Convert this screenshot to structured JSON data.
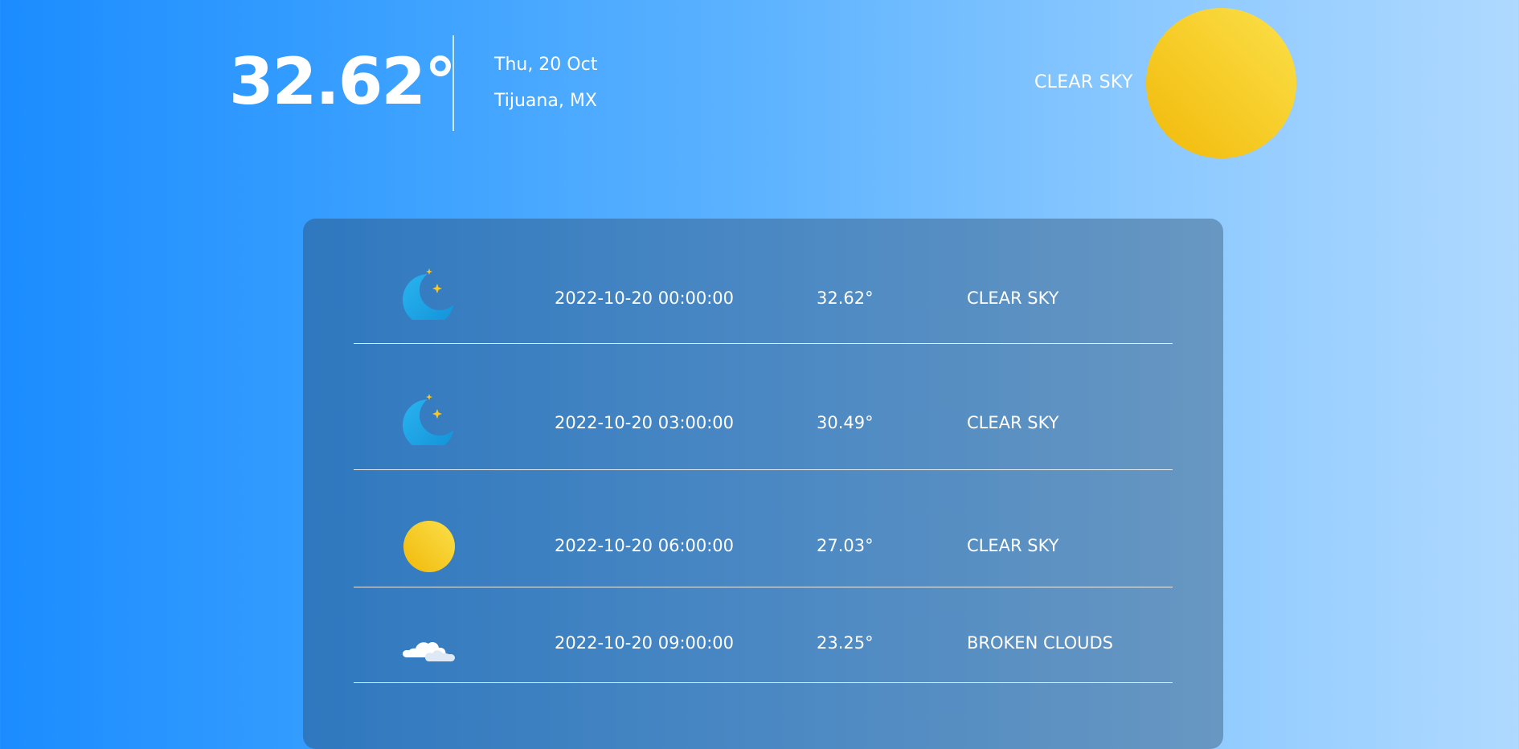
{
  "current": {
    "temperature": "32.62°",
    "date": "Thu, 20 Oct",
    "location": "Tijuana, MX",
    "condition": "CLEAR SKY",
    "icon": "sun-icon"
  },
  "forecast": [
    {
      "time": "2022-10-20 00:00:00",
      "temp": "32.62°",
      "condition": "CLEAR SKY",
      "icon": "moon-stars-icon"
    },
    {
      "time": "2022-10-20 03:00:00",
      "temp": "30.49°",
      "condition": "CLEAR SKY",
      "icon": "moon-stars-icon"
    },
    {
      "time": "2022-10-20 06:00:00",
      "temp": "27.03°",
      "condition": "CLEAR SKY",
      "icon": "sun-icon"
    },
    {
      "time": "2022-10-20 09:00:00",
      "temp": "23.25°",
      "condition": "BROKEN CLOUDS",
      "icon": "cloud-icon"
    }
  ],
  "colors": {
    "background_start": "#1b8cff",
    "background_end": "#afd9ff",
    "panel": "#3a7fc1",
    "sun": "#f7cf2c",
    "moon": "#1ea0e6",
    "star": "#f9c823"
  }
}
